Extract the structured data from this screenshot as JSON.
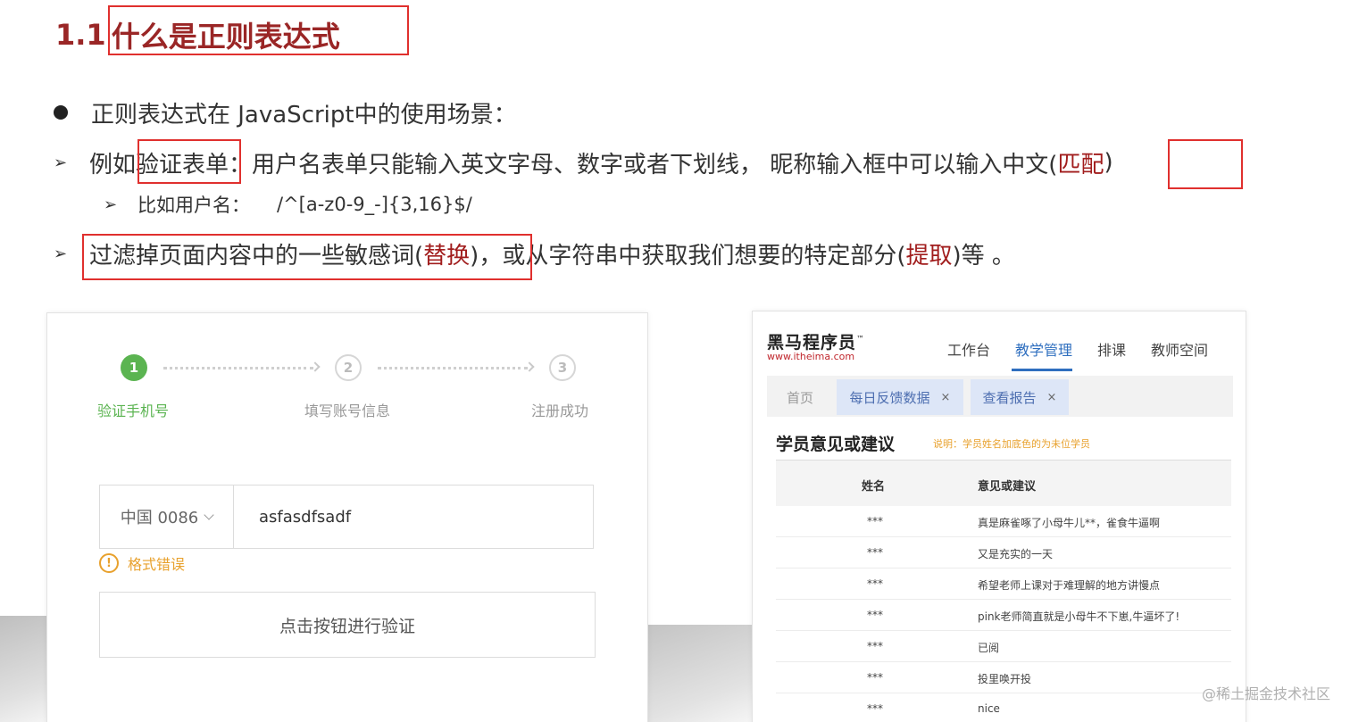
{
  "title": {
    "number": "1.1",
    "text": "什么是正则表达式"
  },
  "bullet": {
    "text": "正则表达式在 JavaScript中的使用场景："
  },
  "item1": {
    "arrow": "➢",
    "prefix": "例如",
    "highlight": "验证表单",
    "rest": "：用户名表单只能输入英文字母、数字或者下划线， 昵称输入框中可以输入中文(",
    "keyword": "匹配",
    "close": ")"
  },
  "item1_sub": {
    "arrow": "➢",
    "label": "比如用户名：",
    "code": "/^[a-z0-9_-]{3,16}$/"
  },
  "item2": {
    "arrow": "➢",
    "part1": "过滤掉页面内容中的一些敏感词(",
    "keyword1": "替换",
    "part2": ")，或从字符串中获取我们想要的特定部分(",
    "keyword2": "提取",
    "part3": ")等 。"
  },
  "register": {
    "steps": [
      {
        "num": "1",
        "label": "验证手机号"
      },
      {
        "num": "2",
        "label": "填写账号信息"
      },
      {
        "num": "3",
        "label": "注册成功"
      }
    ],
    "country": "中国 0086",
    "phone_value": "asfasdfsadf",
    "error_icon": "!",
    "error": "格式错误",
    "button": "点击按钮进行验证"
  },
  "admin": {
    "logo": "黑马程序员",
    "logo_tm": "™",
    "logo_url": "www.itheima.com",
    "nav": [
      "工作台",
      "教学管理",
      "排课",
      "教师空间"
    ],
    "tabs": [
      {
        "label": "首页"
      },
      {
        "label": "每日反馈数据",
        "close": "×"
      },
      {
        "label": "查看报告",
        "close": "×"
      }
    ],
    "section_title": "学员意见或建议",
    "section_note": "说明：学员姓名加底色的为未位学员",
    "columns": [
      "姓名",
      "意见或建议"
    ],
    "rows": [
      {
        "name": "***",
        "suggestion": "真是麻雀啄了小母牛儿**，雀食牛逼啊"
      },
      {
        "name": "***",
        "suggestion": "又是充实的一天"
      },
      {
        "name": "***",
        "suggestion": "希望老师上课对于难理解的地方讲慢点"
      },
      {
        "name": "***",
        "suggestion": "pink老师简直就是小母牛不下崽,牛逼坏了!"
      },
      {
        "name": "***",
        "suggestion": "已阅"
      },
      {
        "name": "***",
        "suggestion": "投里唤开投"
      },
      {
        "name": "***",
        "suggestion": "nice"
      }
    ]
  },
  "watermark": "@稀土掘金技术社区"
}
